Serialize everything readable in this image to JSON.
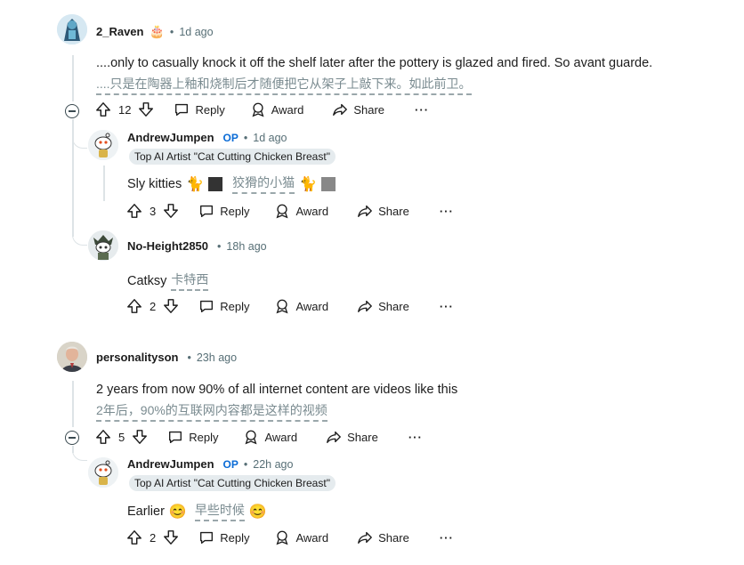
{
  "comments": {
    "c1": {
      "username": "2_Raven",
      "time": "1d ago",
      "text": "....only to casually knock it off the shelf later after the pottery is glazed and fired. So avant guarde.",
      "translation": "....只是在陶器上釉和烧制后才随便把它从架子上敲下来。如此前卫。",
      "score": "12"
    },
    "c2": {
      "username": "AndrewJumpen",
      "op": "OP",
      "time": "1d ago",
      "flair": "Top AI Artist \"Cat Cutting Chicken Breast\"",
      "text": "Sly kitties",
      "translation": "狡猾的小猫",
      "score": "3"
    },
    "c3": {
      "username": "No-Height2850",
      "time": "18h ago",
      "text": "Catksy",
      "translation": "卡特西",
      "score": "2"
    },
    "c4": {
      "username": "personalityson",
      "time": "23h ago",
      "text": "2 years from now 90% of all internet content are videos like this",
      "translation": "2年后，90%的互联网内容都是这样的视频",
      "score": "5"
    },
    "c5": {
      "username": "AndrewJumpen",
      "op": "OP",
      "time": "22h ago",
      "flair": "Top AI Artist \"Cat Cutting Chicken Breast\"",
      "text": "Earlier",
      "translation": "早些时候",
      "score": "2"
    }
  },
  "labels": {
    "reply": "Reply",
    "award": "Award",
    "share": "Share",
    "dot": "•"
  },
  "colors": {
    "op": "#0a6bd6",
    "meta": "#576f76",
    "thread_line": "#dde3e6",
    "flair_bg": "#e5ebee"
  }
}
